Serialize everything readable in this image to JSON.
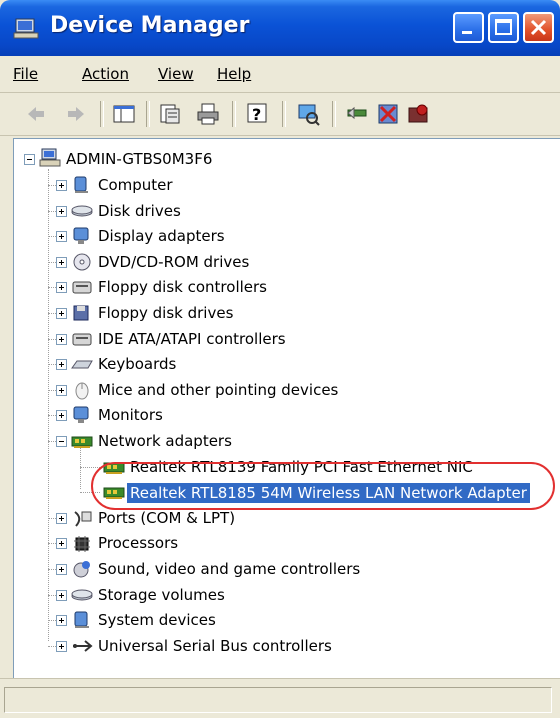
{
  "window": {
    "title": "Device Manager"
  },
  "menu": {
    "items": [
      {
        "label": "File"
      },
      {
        "label": "Action"
      },
      {
        "label": "View"
      },
      {
        "label": "Help"
      }
    ]
  },
  "tree": {
    "root": "ADMIN-GTBS0M3F6",
    "categories": [
      {
        "label": "Computer",
        "icon": "computer-icon"
      },
      {
        "label": "Disk drives",
        "icon": "disk-drive-icon"
      },
      {
        "label": "Display adapters",
        "icon": "monitor-icon"
      },
      {
        "label": "DVD/CD-ROM drives",
        "icon": "cdrom-icon"
      },
      {
        "label": "Floppy disk controllers",
        "icon": "controller-icon"
      },
      {
        "label": "Floppy disk drives",
        "icon": "floppy-icon"
      },
      {
        "label": "IDE ATA/ATAPI controllers",
        "icon": "controller-icon"
      },
      {
        "label": "Keyboards",
        "icon": "keyboard-icon"
      },
      {
        "label": "Mice and other pointing devices",
        "icon": "mouse-icon"
      },
      {
        "label": "Monitors",
        "icon": "monitor-icon"
      },
      {
        "label": "Network adapters",
        "icon": "network-card-icon",
        "expanded": true
      },
      {
        "label": "Ports (COM & LPT)",
        "icon": "port-icon"
      },
      {
        "label": "Processors",
        "icon": "processor-icon"
      },
      {
        "label": "Sound, video and game controllers",
        "icon": "sound-icon"
      },
      {
        "label": "Storage volumes",
        "icon": "storage-icon"
      },
      {
        "label": "System devices",
        "icon": "system-icon"
      },
      {
        "label": "Universal Serial Bus controllers",
        "icon": "usb-icon"
      }
    ],
    "network_children": [
      {
        "label": "Realtek RTL8139 Family PCI Fast Ethernet NIC"
      },
      {
        "label": "Realtek RTL8185 54M Wireless LAN Network Adapter",
        "selected": true
      }
    ]
  },
  "colors": {
    "titlebar": "#0a52d6",
    "selection": "#316ac5",
    "highlight_oval": "#e23030"
  }
}
